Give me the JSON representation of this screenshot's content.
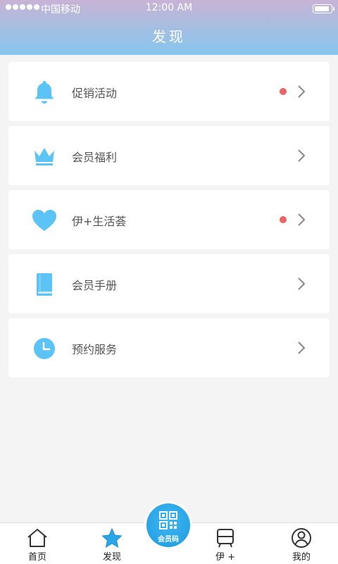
{
  "status_bar": {
    "carrier": "中国移动",
    "time": "12:00 AM"
  },
  "header": {
    "title": "发现"
  },
  "menu": [
    {
      "label": "促销活动",
      "icon": "bell-icon",
      "has_dot": true
    },
    {
      "label": "会员福利",
      "icon": "crown-icon",
      "has_dot": false
    },
    {
      "label": "伊+生活荟",
      "icon": "heart-icon",
      "has_dot": true
    },
    {
      "label": "会员手册",
      "icon": "book-icon",
      "has_dot": false
    },
    {
      "label": "预约服务",
      "icon": "clock-icon",
      "has_dot": false
    }
  ],
  "tabbar": {
    "tabs": [
      {
        "label": "首页",
        "icon": "home-icon"
      },
      {
        "label": "发现",
        "icon": "star-icon"
      },
      {
        "label": "伊 +",
        "icon": "cart-icon"
      },
      {
        "label": "我的",
        "icon": "user-icon"
      }
    ],
    "center": {
      "label": "会员码",
      "icon": "qr-code-icon"
    }
  },
  "colors": {
    "accent": "#5bc3f5",
    "dot": "#ea6464",
    "star": "#2aa5e8"
  }
}
